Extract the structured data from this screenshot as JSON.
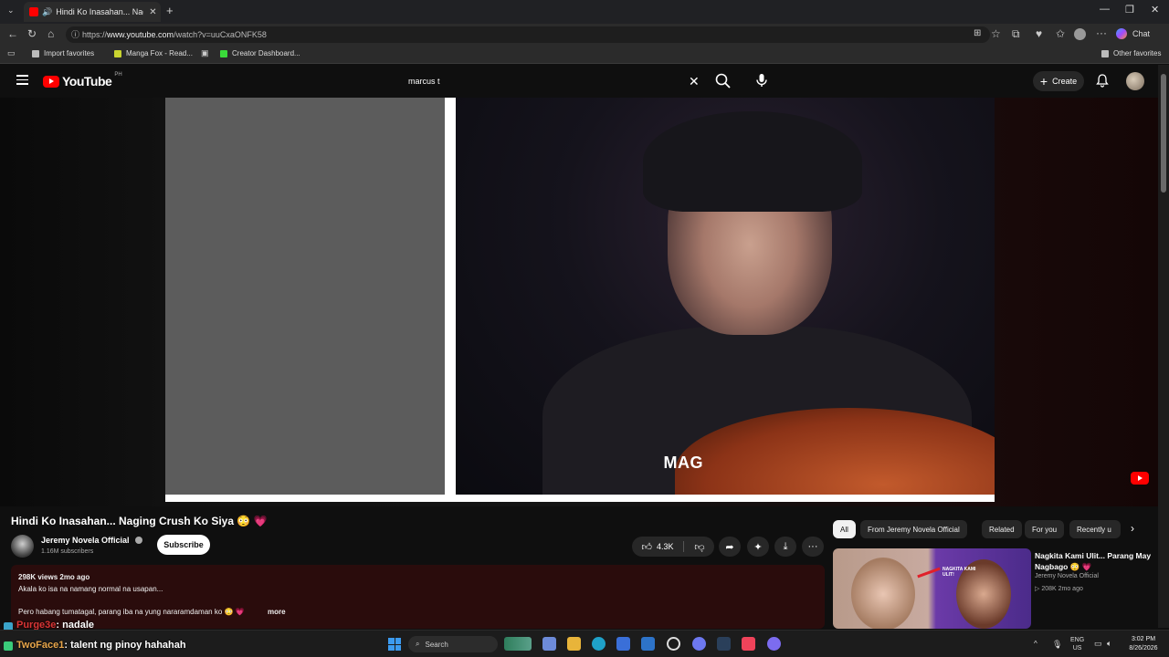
{
  "browser": {
    "tab_title": "Hindi Ko Inasahan... Naging C",
    "tab_close": "✕",
    "new_tab": "+",
    "url_prefix": "https://",
    "url_host": "www.youtube.com",
    "url_path": "/watch?v=uuCxaONFK58",
    "bookmarks": [
      "Import favorites",
      "Manga Fox - Read...",
      "Creator Dashboard..."
    ],
    "other_favorites": "Other favorites",
    "chat_label": "Chat"
  },
  "youtube": {
    "logo_text": "YouTube",
    "country_code": "PH",
    "search_value": "marcus t",
    "create_label": "Create"
  },
  "video": {
    "caption": "MAG",
    "title": "Hindi Ko Inasahan... Naging Crush Ko Siya 😳 💗",
    "channel": "Jeremy Novela Official",
    "subscribers": "1.16M subscribers",
    "subscribe_label": "Subscribe",
    "likes": "4.3K",
    "description": {
      "meta": "298K views  2mo ago",
      "line1": "Akala ko isa na namang normal na usapan...",
      "line2": "Pero habang tumatagal, parang iba na yung nararamdaman ko 😳 💗",
      "more": "more"
    }
  },
  "chips": [
    "All",
    "From Jeremy Novela Official",
    "Related",
    "For you",
    "Recently u"
  ],
  "recommendation": {
    "thumb_text": "NAGKITA KAMI ULIT!",
    "title": "Nagkita Kami Ulit... Parang May Nagbago 😳 💗",
    "channel": "Jeremy Novela Official",
    "views": "▷ 208K  2mo ago"
  },
  "chat": [
    {
      "user": "Purge3e",
      "message": ": nadale",
      "color": "#d93535"
    },
    {
      "user": "TwoFace1",
      "message": ": talent ng pinoy hahahah",
      "color": "#e8a64a"
    }
  ],
  "taskbar": {
    "search_label": "Search",
    "lang": "ENG",
    "region": "US",
    "time": "3:02 PM",
    "date": "8/26/2026"
  },
  "colors": {
    "accent": "#ff0000",
    "description_bg": "#2a0c0c",
    "page_bg": "#0f0f0f"
  }
}
